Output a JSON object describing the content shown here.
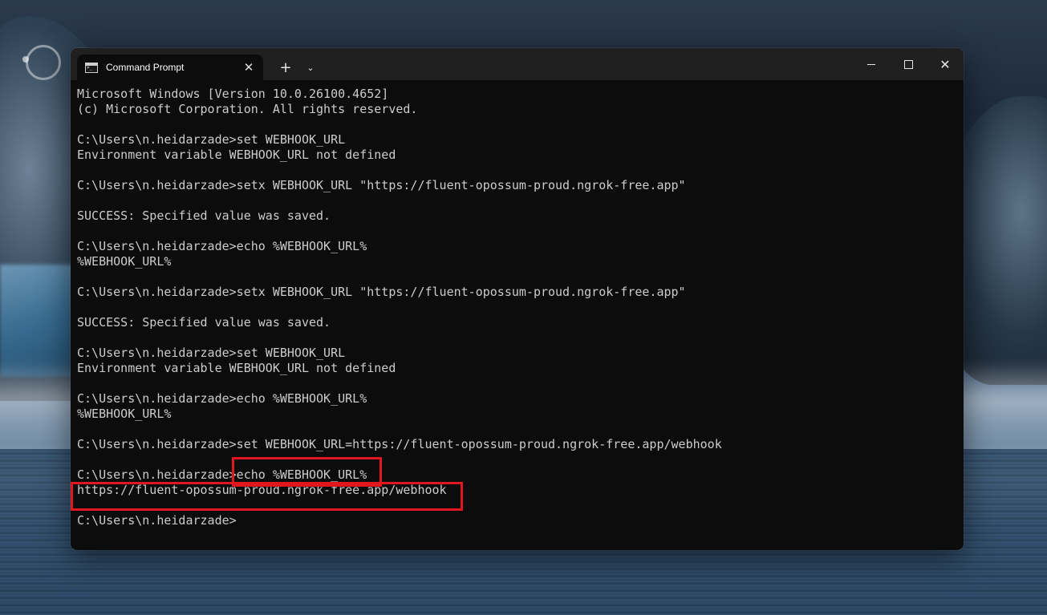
{
  "window": {
    "tab_title": "Command Prompt",
    "close_tab_glyph": "✕",
    "new_tab_glyph": "+",
    "dropdown_glyph": "⌄",
    "close_window_glyph": "✕"
  },
  "terminal": {
    "lines": [
      "Microsoft Windows [Version 10.0.26100.4652]",
      "(c) Microsoft Corporation. All rights reserved.",
      "",
      "C:\\Users\\n.heidarzade>set WEBHOOK_URL",
      "Environment variable WEBHOOK_URL not defined",
      "",
      "C:\\Users\\n.heidarzade>setx WEBHOOK_URL \"https://fluent-opossum-proud.ngrok-free.app\"",
      "",
      "SUCCESS: Specified value was saved.",
      "",
      "C:\\Users\\n.heidarzade>echo %WEBHOOK_URL%",
      "%WEBHOOK_URL%",
      "",
      "C:\\Users\\n.heidarzade>setx WEBHOOK_URL \"https://fluent-opossum-proud.ngrok-free.app\"",
      "",
      "SUCCESS: Specified value was saved.",
      "",
      "C:\\Users\\n.heidarzade>set WEBHOOK_URL",
      "Environment variable WEBHOOK_URL not defined",
      "",
      "C:\\Users\\n.heidarzade>echo %WEBHOOK_URL%",
      "%WEBHOOK_URL%",
      "",
      "C:\\Users\\n.heidarzade>set WEBHOOK_URL=https://fluent-opossum-proud.ngrok-free.app/webhook",
      "",
      "C:\\Users\\n.heidarzade>echo %WEBHOOK_URL%",
      "https://fluent-opossum-proud.ngrok-free.app/webhook",
      "",
      "C:\\Users\\n.heidarzade>"
    ]
  },
  "colors": {
    "highlight": "#e0181e",
    "terminal_bg": "#0c0c0c",
    "terminal_text": "#cccccc"
  }
}
